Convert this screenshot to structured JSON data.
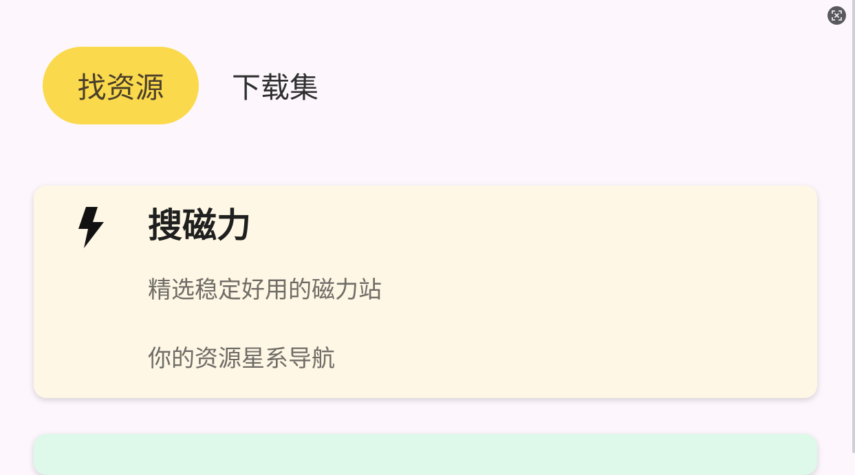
{
  "tabs": [
    {
      "label": "找资源",
      "active": true
    },
    {
      "label": "下载集",
      "active": false
    }
  ],
  "cards": [
    {
      "icon": "lightning-bolt-icon",
      "title": "搜磁力",
      "lines": [
        "精选稳定好用的磁力站",
        "你的资源星系导航"
      ],
      "background": "#fef7e5"
    },
    {
      "background": "#def8ea"
    }
  ],
  "colors": {
    "page_background": "#fdf7fd",
    "active_tab": "#fbd94c",
    "corner_button": "#5a5a5e"
  },
  "corner_button": {
    "icon": "screen-capture-icon"
  }
}
